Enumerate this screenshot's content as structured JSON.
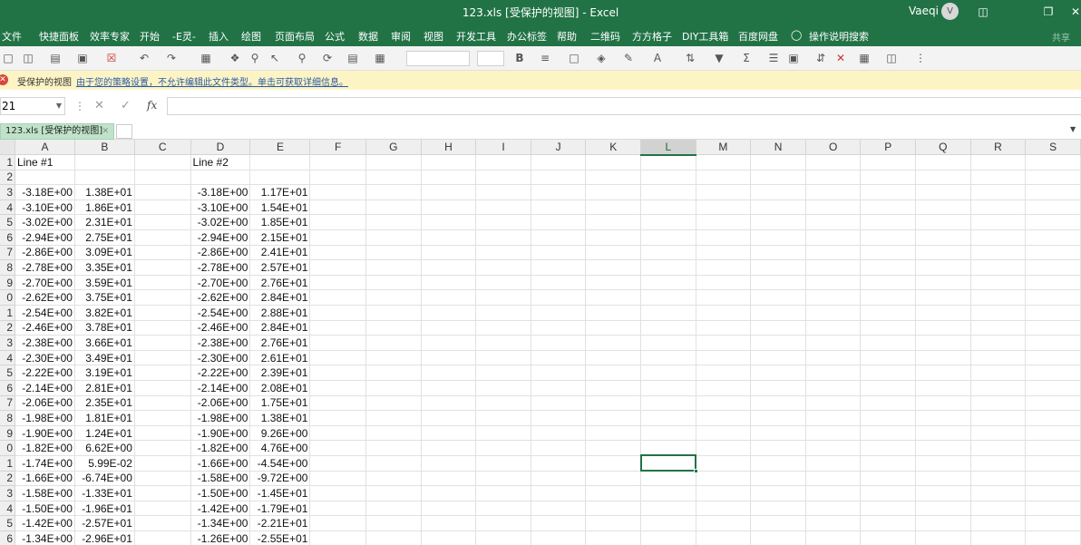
{
  "titlebar": {
    "title": "123.xls  [受保护的视图]  -  Excel",
    "user": "Vaeqi",
    "avatar": "V",
    "win_icons": [
      "ribbon-display-icon",
      "restore-icon",
      "close-icon"
    ]
  },
  "menu": [
    "文件",
    "快捷面板",
    "效率专家",
    "开始",
    "-E灵-",
    "插入",
    "绘图",
    "页面布局",
    "公式",
    "数据",
    "审阅",
    "视图",
    "开发工具",
    "办公标签",
    "帮助",
    "二维码",
    "方方格子",
    "DIY工具箱",
    "百度网盘",
    "操作说明搜索"
  ],
  "share_label": "共享",
  "infobar": {
    "title": "受保护的视图",
    "message": "由于您的策略设置，不允许编辑此文件类型。单击可获取详细信息。"
  },
  "formula": {
    "name_box": "21",
    "fx": "fx",
    "value": ""
  },
  "tab": {
    "label": "123.xls  [受保护的视图]"
  },
  "sheet": {
    "columns": [
      "A",
      "B",
      "C",
      "D",
      "E",
      "F",
      "G",
      "H",
      "I",
      "J",
      "K",
      "L",
      "M",
      "N",
      "O",
      "P",
      "Q",
      "R",
      "S"
    ],
    "selected_column": "L",
    "row_numbers": [
      "1",
      "2",
      "3",
      "4",
      "5",
      "6",
      "7",
      "8",
      "9",
      "0",
      "1",
      "2",
      "3",
      "4",
      "5",
      "6",
      "7",
      "8",
      "9",
      "0",
      "1",
      "2",
      "3",
      "4",
      "5",
      "6"
    ],
    "header_row": {
      "A": "Line #1",
      "D": "Line #2"
    },
    "rows": [
      [
        "-3.18E+00",
        "1.38E+01",
        "-3.18E+00",
        "1.17E+01"
      ],
      [
        "-3.10E+00",
        "1.86E+01",
        "-3.10E+00",
        "1.54E+01"
      ],
      [
        "-3.02E+00",
        "2.31E+01",
        "-3.02E+00",
        "1.85E+01"
      ],
      [
        "-2.94E+00",
        "2.75E+01",
        "-2.94E+00",
        "2.15E+01"
      ],
      [
        "-2.86E+00",
        "3.09E+01",
        "-2.86E+00",
        "2.41E+01"
      ],
      [
        "-2.78E+00",
        "3.35E+01",
        "-2.78E+00",
        "2.57E+01"
      ],
      [
        "-2.70E+00",
        "3.59E+01",
        "-2.70E+00",
        "2.76E+01"
      ],
      [
        "-2.62E+00",
        "3.75E+01",
        "-2.62E+00",
        "2.84E+01"
      ],
      [
        "-2.54E+00",
        "3.82E+01",
        "-2.54E+00",
        "2.88E+01"
      ],
      [
        "-2.46E+00",
        "3.78E+01",
        "-2.46E+00",
        "2.84E+01"
      ],
      [
        "-2.38E+00",
        "3.66E+01",
        "-2.38E+00",
        "2.76E+01"
      ],
      [
        "-2.30E+00",
        "3.49E+01",
        "-2.30E+00",
        "2.61E+01"
      ],
      [
        "-2.22E+00",
        "3.19E+01",
        "-2.22E+00",
        "2.39E+01"
      ],
      [
        "-2.14E+00",
        "2.81E+01",
        "-2.14E+00",
        "2.08E+01"
      ],
      [
        "-2.06E+00",
        "2.35E+01",
        "-2.06E+00",
        "1.75E+01"
      ],
      [
        "-1.98E+00",
        "1.81E+01",
        "-1.98E+00",
        "1.38E+01"
      ],
      [
        "-1.90E+00",
        "1.24E+01",
        "-1.90E+00",
        "9.26E+00"
      ],
      [
        "-1.82E+00",
        "6.62E+00",
        "-1.82E+00",
        "4.76E+00"
      ],
      [
        "-1.74E+00",
        "5.99E-02",
        "-1.66E+00",
        "-4.54E+00"
      ],
      [
        "-1.66E+00",
        "-6.74E+00",
        "-1.58E+00",
        "-9.72E+00"
      ],
      [
        "-1.58E+00",
        "-1.33E+01",
        "-1.50E+00",
        "-1.45E+01"
      ],
      [
        "-1.50E+00",
        "-1.96E+01",
        "-1.42E+00",
        "-1.79E+01"
      ],
      [
        "-1.42E+00",
        "-2.57E+01",
        "-1.34E+00",
        "-2.21E+01"
      ],
      [
        "-1.34E+00",
        "-2.96E+01",
        "-1.26E+00",
        "-2.55E+01"
      ]
    ]
  }
}
